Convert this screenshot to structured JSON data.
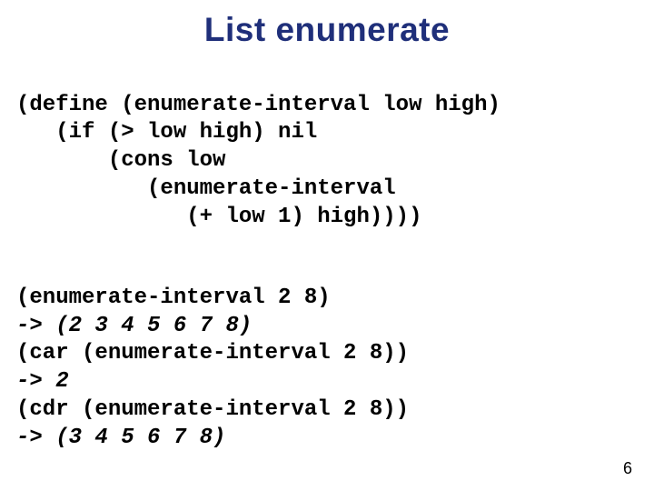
{
  "title": "List enumerate",
  "code1": {
    "l1": "(define (enumerate-interval low high)",
    "l2": "   (if (> low high) nil",
    "l3": "       (cons low",
    "l4": "          (enumerate-interval",
    "l5": "             (+ low 1) high))))"
  },
  "code2": {
    "l1": "(enumerate-interval 2 8)",
    "l2": "-> (2 3 4 5 6 7 8)",
    "l3": "(car (enumerate-interval 2 8))",
    "l4": "-> 2",
    "l5": "(cdr (enumerate-interval 2 8))",
    "l6": "-> (3 4 5 6 7 8)"
  },
  "pagenum": "6"
}
